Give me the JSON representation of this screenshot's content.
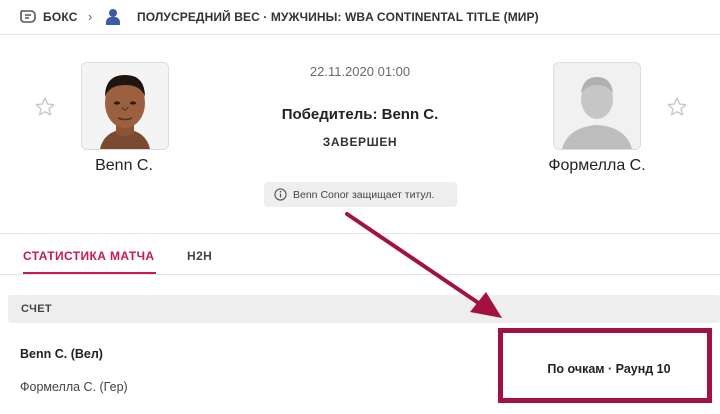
{
  "breadcrumb": {
    "sport": "БОКС",
    "separator": "›",
    "tournament": "ПОЛУСРЕДНИЙ ВЕС · МУЖЧИНЫ: WBA CONTINENTAL TITLE (МИР)"
  },
  "match": {
    "date_time": "22.11.2020 01:00",
    "winner_text": "Победитель: Benn C.",
    "status": "ЗАВЕРШЕН",
    "info_note": "Benn Conor защищает титул."
  },
  "fighters": {
    "home": {
      "name": "Benn C."
    },
    "away": {
      "name": "Формелла С."
    }
  },
  "tabs": [
    {
      "label": "СТАТИСТИКА МАТЧА",
      "active": true
    },
    {
      "label": "H2H",
      "active": false
    }
  ],
  "score": {
    "header": "СЧЕТ",
    "rows": [
      {
        "name": "Benn C. (Вел)"
      },
      {
        "name": "Формелла С. (Гер)"
      }
    ],
    "result": "По очкам · Раунд 10"
  },
  "colors": {
    "accent": "#c8194b",
    "highlight_box": "#a3123f",
    "pill_bg": "#eeeeee"
  },
  "icons": [
    "boxing-glove-icon",
    "person-icon",
    "star-icon",
    "info-icon",
    "arrow-annotation"
  ]
}
